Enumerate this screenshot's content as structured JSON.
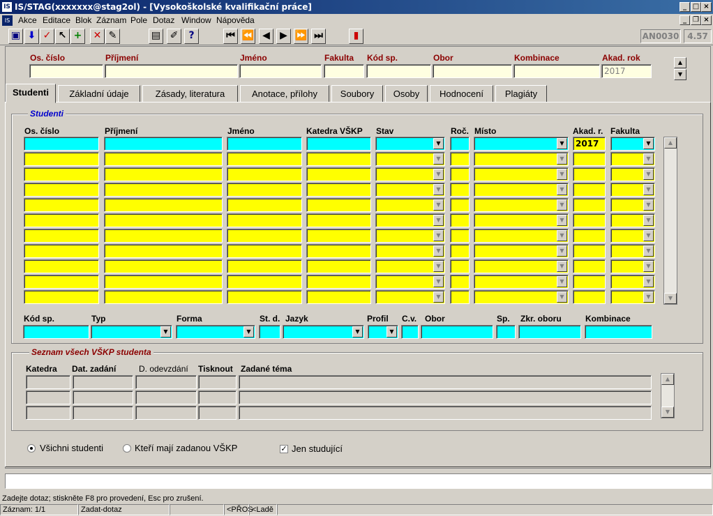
{
  "window": {
    "title": "IS/STAG(xxxxxxx@stag2ol) - [Vysokoškolské kvalifikační práce]"
  },
  "menu": [
    "Akce",
    "Editace",
    "Blok",
    "Záznam",
    "Pole",
    "Dotaz",
    "Window",
    "Nápověda"
  ],
  "toolbar": {
    "form_code": "AN0030",
    "version": "4.57"
  },
  "header": {
    "labels": [
      "Os. číslo",
      "Příjmení",
      "Jméno",
      "Fakulta",
      "Kód sp.",
      "Obor",
      "Kombinace",
      "Akad. rok"
    ],
    "akad_rok_value": "2017"
  },
  "tabs": [
    "Studenti",
    "Základní údaje",
    "Zásady, literatura",
    "Anotace, přílohy",
    "Soubory",
    "Osoby",
    "Hodnocení",
    "Plagiáty"
  ],
  "students": {
    "title": "Studenti",
    "columns": [
      "Os. číslo",
      "Příjmení",
      "Jméno",
      "Katedra VŠKP",
      "Stav",
      "Roč.",
      "Místo",
      "Akad. r.",
      "Fakulta"
    ],
    "first_row_akad": "2017",
    "rows": 11
  },
  "detail": {
    "labels": [
      "Kód sp.",
      "Typ",
      "Forma",
      "St. d.",
      "Jazyk",
      "Profil",
      "C.v.",
      "Obor",
      "Sp.",
      "Zkr. oboru",
      "Kombinace"
    ]
  },
  "vskp": {
    "title": "Seznam všech VŠKP studenta",
    "columns": [
      "Katedra",
      "Dat. zadání",
      "D. odevzdání",
      "Tisknout",
      "Zadané téma"
    ]
  },
  "filters": {
    "all": "Všichni studenti",
    "with_vskp": "Kteří mají zadanou VŠKP",
    "only_studying": "Jen studující"
  },
  "status": {
    "message": "Zadejte dotaz; stiskněte F8 pro provedení, Esc  pro zrušení.",
    "record": "Záznam: 1/1",
    "mode": "Zadat-dotaz",
    "pros": "<PŘOS",
    "lade": "<Ladě"
  },
  "colors": {
    "query_field": "#00ffff",
    "list_field": "#ffff00",
    "label_red": "#8b0000",
    "group_title_blue": "#0000cc"
  }
}
